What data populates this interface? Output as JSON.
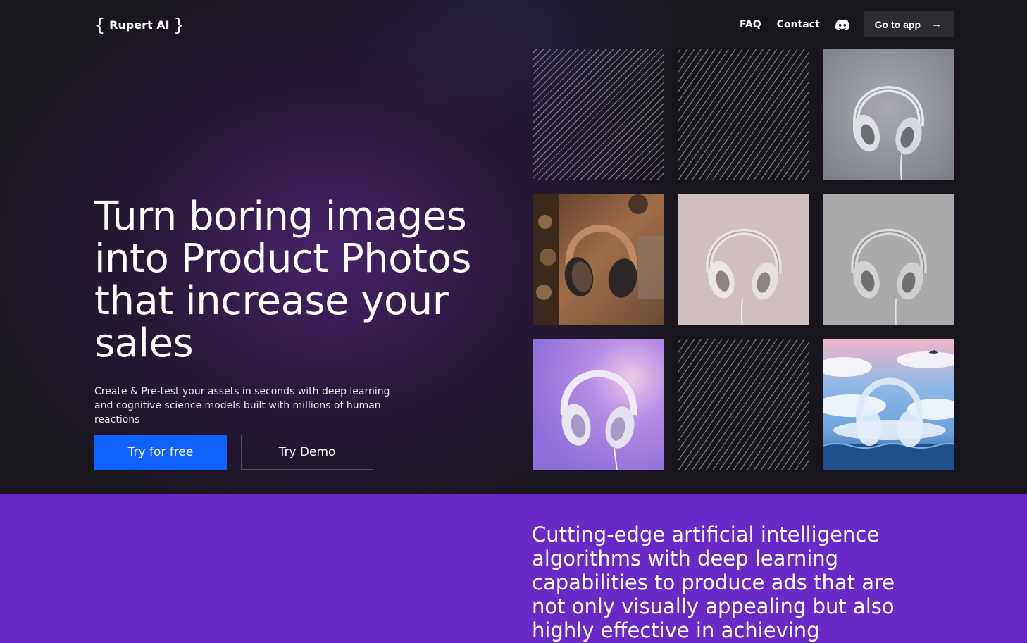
{
  "header": {
    "logo_open": "{",
    "logo_name": "Rupert AI",
    "logo_close": "}",
    "nav": {
      "faq": "FAQ",
      "contact": "Contact",
      "discord_icon": "discord-icon",
      "go_to_app": "Go to app",
      "arrow_icon": "arrow-right-icon"
    }
  },
  "hero": {
    "headline": "Turn boring images into Product Photos that increase your sales",
    "subtext": "Create & Pre-test your assets in seconds with deep learning and cognitive science models built with millions of human reactions",
    "primary_cta": "Try for free",
    "secondary_cta": "Try Demo"
  },
  "gallery": {
    "tiles": [
      {
        "kind": "pattern"
      },
      {
        "kind": "pattern"
      },
      {
        "kind": "image",
        "subject": "white headphones on grey background"
      },
      {
        "kind": "image",
        "subject": "copper headphones with ornate background"
      },
      {
        "kind": "image",
        "subject": "white headphones on pink background"
      },
      {
        "kind": "image",
        "subject": "white headphones on light grey background"
      },
      {
        "kind": "image",
        "subject": "white headphones on purple background"
      },
      {
        "kind": "pattern"
      },
      {
        "kind": "image",
        "subject": "headphones in clouds over ocean"
      }
    ]
  },
  "section2": {
    "text": "Cutting-edge artificial intelligence algorithms with deep learning capabilities to produce ads that are not only visually appealing but also highly effective in achieving"
  },
  "colors": {
    "accent_blue": "#0f62fe",
    "purple": "#6a28c6",
    "bg_dark": "#18161c"
  }
}
